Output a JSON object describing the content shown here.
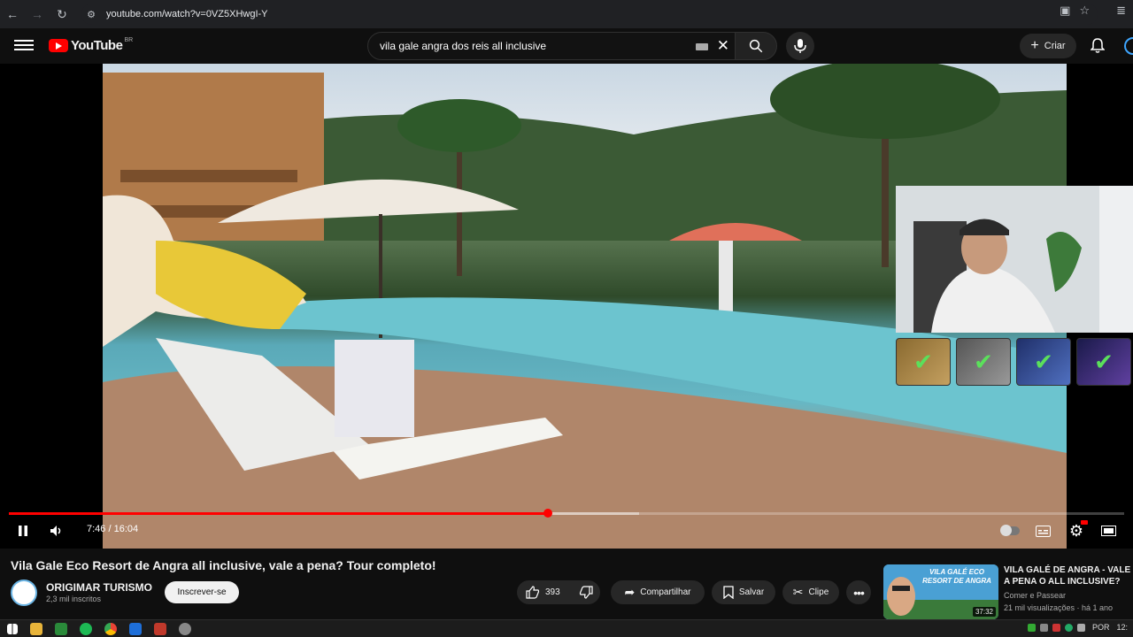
{
  "browser": {
    "url": "youtube.com/watch?v=0VZ5XHwgI-Y"
  },
  "header": {
    "logo_text": "YouTube",
    "country_code": "BR",
    "search_query": "vila gale angra dos reis all inclusive",
    "create_label": "Criar"
  },
  "player": {
    "time_current": "7:46",
    "time_separator": "/",
    "time_total": "16:04",
    "played_fraction": 0.4834,
    "buffered_fraction": 0.565
  },
  "video": {
    "title": "Vila Gale Eco Resort de Angra all inclusive, vale a pena? Tour completo!",
    "channel_name": "ORIGIMAR TURISMO",
    "channel_subs": "2,3 mil inscritos",
    "subscribe_label": "Inscrever-se",
    "likes": "393",
    "share_label": "Compartilhar",
    "save_label": "Salvar",
    "clip_label": "Clipe"
  },
  "recommended": {
    "thumb_text": "VILA GALÉ ECO RESORT DE ANGRA",
    "duration": "37:32",
    "title": "VILA GALÉ DE ANGRA - VALE A PENA O ALL INCLUSIVE?",
    "channel": "Comer e Passear",
    "meta": "21 mil visualizações · há 1 ano"
  },
  "taskbar": {
    "language": "POR",
    "clock": "12:"
  }
}
